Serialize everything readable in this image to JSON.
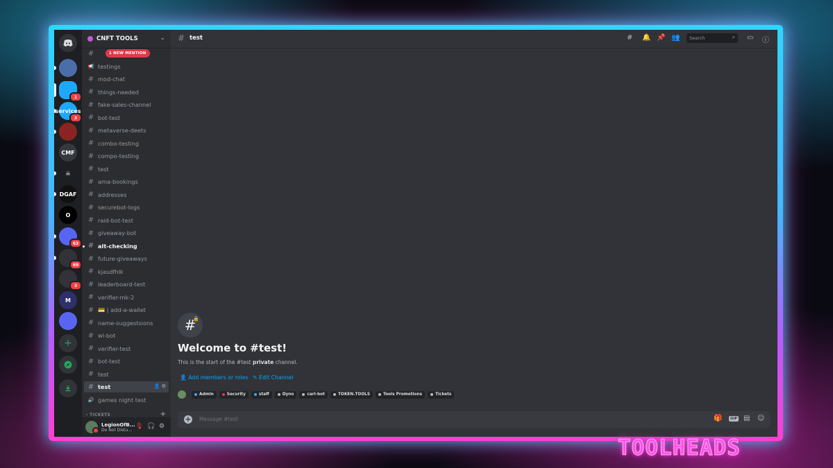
{
  "server": {
    "name": "CNFT TOOLS",
    "chevron_icon": "chevron-down-icon"
  },
  "rail": {
    "home_icon": "discord-logo-icon",
    "servers": [
      {
        "label": "",
        "color": "#4a6ea9",
        "badge": ""
      },
      {
        "label": "",
        "color": "#1ea7ff",
        "badge": "1"
      },
      {
        "label": "services",
        "color": "#1ea7ff",
        "badge": "3"
      },
      {
        "label": "",
        "color": "#8b2323",
        "badge": ""
      },
      {
        "label": "CMF",
        "color": "#36393f",
        "badge": ""
      },
      {
        "label": "☠",
        "color": "#1e1f22",
        "badge": ""
      },
      {
        "label": "DGAF",
        "color": "#111111",
        "badge": ""
      },
      {
        "label": "O",
        "color": "#000000",
        "badge": ""
      },
      {
        "label": "",
        "color": "#5865f2",
        "badge": "63"
      },
      {
        "label": "",
        "color": "#313338",
        "badge": "69"
      },
      {
        "label": "",
        "color": "#313338",
        "badge": "3"
      },
      {
        "label": "M",
        "color": "#2e2f6b",
        "badge": ""
      },
      {
        "label": "",
        "color": "#5865f2",
        "badge": ""
      }
    ],
    "add_server_icon": "plus-icon",
    "explore_icon": "compass-icon",
    "download_icon": "download-icon"
  },
  "mention_pill": "1 NEW MENTION",
  "channels": [
    {
      "name": "",
      "type": "text",
      "state": ""
    },
    {
      "name": "testings",
      "type": "announce",
      "state": ""
    },
    {
      "name": "mod-chat",
      "type": "text",
      "state": ""
    },
    {
      "name": "things-needed",
      "type": "text",
      "state": ""
    },
    {
      "name": "fake-sales-channel",
      "type": "text",
      "state": ""
    },
    {
      "name": "bot-test",
      "type": "text",
      "state": ""
    },
    {
      "name": "metaverse-deets",
      "type": "text",
      "state": ""
    },
    {
      "name": "combo-testing",
      "type": "text",
      "state": ""
    },
    {
      "name": "compo-testing",
      "type": "text",
      "state": ""
    },
    {
      "name": "test",
      "type": "text",
      "state": ""
    },
    {
      "name": "ama-bookings",
      "type": "text",
      "state": ""
    },
    {
      "name": "addresses",
      "type": "text",
      "state": ""
    },
    {
      "name": "securebot-logs",
      "type": "text",
      "state": ""
    },
    {
      "name": "raid-bot-test",
      "type": "text",
      "state": ""
    },
    {
      "name": "giveaway-bot",
      "type": "text",
      "state": ""
    },
    {
      "name": "alt-checking",
      "type": "text",
      "state": "unread"
    },
    {
      "name": "future-giveaways",
      "type": "text",
      "state": ""
    },
    {
      "name": "kjasdfhlk",
      "type": "text",
      "state": ""
    },
    {
      "name": "leaderboard-test",
      "type": "text",
      "state": ""
    },
    {
      "name": "verifier-mk-2",
      "type": "text",
      "state": ""
    },
    {
      "name": "💳 | add-a-wallet",
      "type": "text",
      "state": ""
    },
    {
      "name": "name-suggestsions",
      "type": "text",
      "state": ""
    },
    {
      "name": "wl-bot",
      "type": "text",
      "state": ""
    },
    {
      "name": "verifier-test",
      "type": "text",
      "state": ""
    },
    {
      "name": "bot-test",
      "type": "text",
      "state": ""
    },
    {
      "name": "test",
      "type": "text",
      "state": ""
    },
    {
      "name": "test",
      "type": "text",
      "state": "active"
    },
    {
      "name": "games night test",
      "type": "voice",
      "state": ""
    }
  ],
  "category": {
    "label": "TICKETS"
  },
  "user": {
    "name": "LegionOfB...",
    "status": "Do Not Distu..."
  },
  "header": {
    "channel": "test",
    "search_placeholder": "Search"
  },
  "welcome": {
    "title": "Welcome to #test!",
    "sub_prefix": "This is the start of the #test ",
    "sub_bold": "private",
    "sub_suffix": " channel.",
    "add_members": "Add members or roles",
    "edit_channel": "Edit Channel"
  },
  "roles": [
    {
      "name": "Admin",
      "color": "#3ba5ff"
    },
    {
      "name": "Security",
      "color": "#e03a4a"
    },
    {
      "name": "staff",
      "color": "#3ba5ff"
    },
    {
      "name": "Dyno",
      "color": "#b5bac1"
    },
    {
      "name": "carl-bot",
      "color": "#b5bac1"
    },
    {
      "name": "TOKEN.TOOLS",
      "color": "#b5bac1"
    },
    {
      "name": "Tools Promotions",
      "color": "#b5bac1"
    },
    {
      "name": "Tickets",
      "color": "#b5bac1"
    }
  ],
  "composer": {
    "placeholder": "Message #test"
  },
  "watermark": "TOOLHEADS",
  "colors": {
    "accent": "#5865f2",
    "link": "#00a8fc",
    "danger": "#f23f43",
    "frame_cyan": "#2fd6ff",
    "frame_pink": "#ff3fd0"
  }
}
